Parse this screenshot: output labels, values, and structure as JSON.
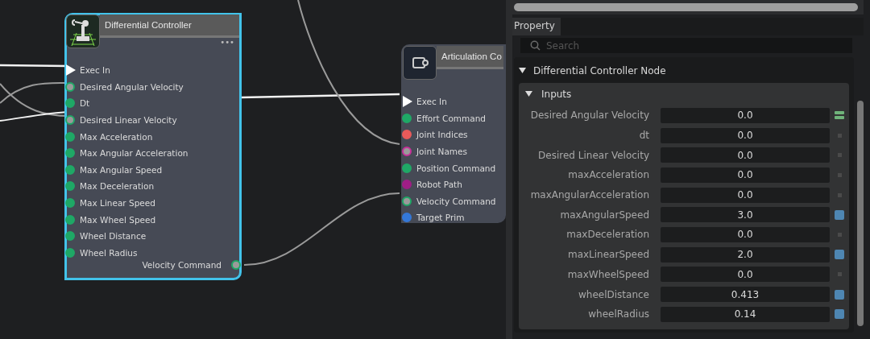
{
  "graph": {
    "nodes": [
      {
        "title": "Differential Controller",
        "selected": true,
        "menu": "•••",
        "inputs": [
          {
            "label": "Exec In",
            "kind": "exec",
            "color": "#ffffff",
            "connected": true
          },
          {
            "label": "Desired Angular Velocity",
            "kind": "data",
            "color": "#1fa866",
            "connected": true
          },
          {
            "label": "Dt",
            "kind": "data",
            "color": "#1fa866",
            "connected": false
          },
          {
            "label": "Desired Linear Velocity",
            "kind": "data",
            "color": "#1fa866",
            "connected": true
          },
          {
            "label": "Max Acceleration",
            "kind": "data",
            "color": "#1fa866",
            "connected": false
          },
          {
            "label": "Max Angular Acceleration",
            "kind": "data",
            "color": "#1fa866",
            "connected": false
          },
          {
            "label": "Max Angular Speed",
            "kind": "data",
            "color": "#1fa866",
            "connected": false
          },
          {
            "label": "Max Deceleration",
            "kind": "data",
            "color": "#1fa866",
            "connected": false
          },
          {
            "label": "Max Linear Speed",
            "kind": "data",
            "color": "#1fa866",
            "connected": false
          },
          {
            "label": "Max Wheel Speed",
            "kind": "data",
            "color": "#1fa866",
            "connected": false
          },
          {
            "label": "Wheel Distance",
            "kind": "data",
            "color": "#1fa866",
            "connected": false
          },
          {
            "label": "Wheel Radius",
            "kind": "data",
            "color": "#1fa866",
            "connected": false
          }
        ],
        "outputs": [
          {
            "label": "Velocity Command",
            "kind": "data",
            "color": "#1fa866",
            "connected": true
          }
        ]
      },
      {
        "title": "Articulation Co",
        "selected": false,
        "inputs": [
          {
            "label": "Exec In",
            "kind": "exec",
            "color": "#ffffff",
            "connected": true
          },
          {
            "label": "Effort Command",
            "kind": "data",
            "color": "#1fa866",
            "connected": false
          },
          {
            "label": "Joint Indices",
            "kind": "data",
            "color": "#e85a5a",
            "connected": false
          },
          {
            "label": "Joint Names",
            "kind": "data",
            "color": "#c8309a",
            "connected": true
          },
          {
            "label": "Position Command",
            "kind": "data",
            "color": "#1fa866",
            "connected": false
          },
          {
            "label": "Robot Path",
            "kind": "data",
            "color": "#a01e86",
            "connected": false
          },
          {
            "label": "Velocity Command",
            "kind": "data",
            "color": "#1fa866",
            "connected": true
          },
          {
            "label": "Target Prim",
            "kind": "data",
            "color": "#3478d8",
            "connected": false
          }
        ]
      }
    ]
  },
  "property_panel": {
    "tab": {
      "label": "Property",
      "selected": true
    },
    "search": {
      "placeholder": "Search"
    },
    "section": {
      "title": "Differential Controller Node",
      "expanded": true,
      "group": {
        "title": "Inputs",
        "expanded": true,
        "rows": [
          {
            "label": "Desired Angular Velocity",
            "value": "0.0",
            "kind": "connected"
          },
          {
            "label": "dt",
            "value": "0.0",
            "kind": "default"
          },
          {
            "label": "Desired Linear Velocity",
            "value": "0.0",
            "kind": "default"
          },
          {
            "label": "maxAcceleration",
            "value": "0.0",
            "kind": "default"
          },
          {
            "label": "maxAngularAcceleration",
            "value": "0.0",
            "kind": "default"
          },
          {
            "label": "maxAngularSpeed",
            "value": "3.0",
            "kind": "modified"
          },
          {
            "label": "maxDeceleration",
            "value": "0.0",
            "kind": "default"
          },
          {
            "label": "maxLinearSpeed",
            "value": "2.0",
            "kind": "modified"
          },
          {
            "label": "maxWheelSpeed",
            "value": "0.0",
            "kind": "default"
          },
          {
            "label": "wheelDistance",
            "value": "0.413",
            "kind": "modified"
          },
          {
            "label": "wheelRadius",
            "value": "0.14",
            "kind": "modified"
          }
        ]
      }
    }
  }
}
